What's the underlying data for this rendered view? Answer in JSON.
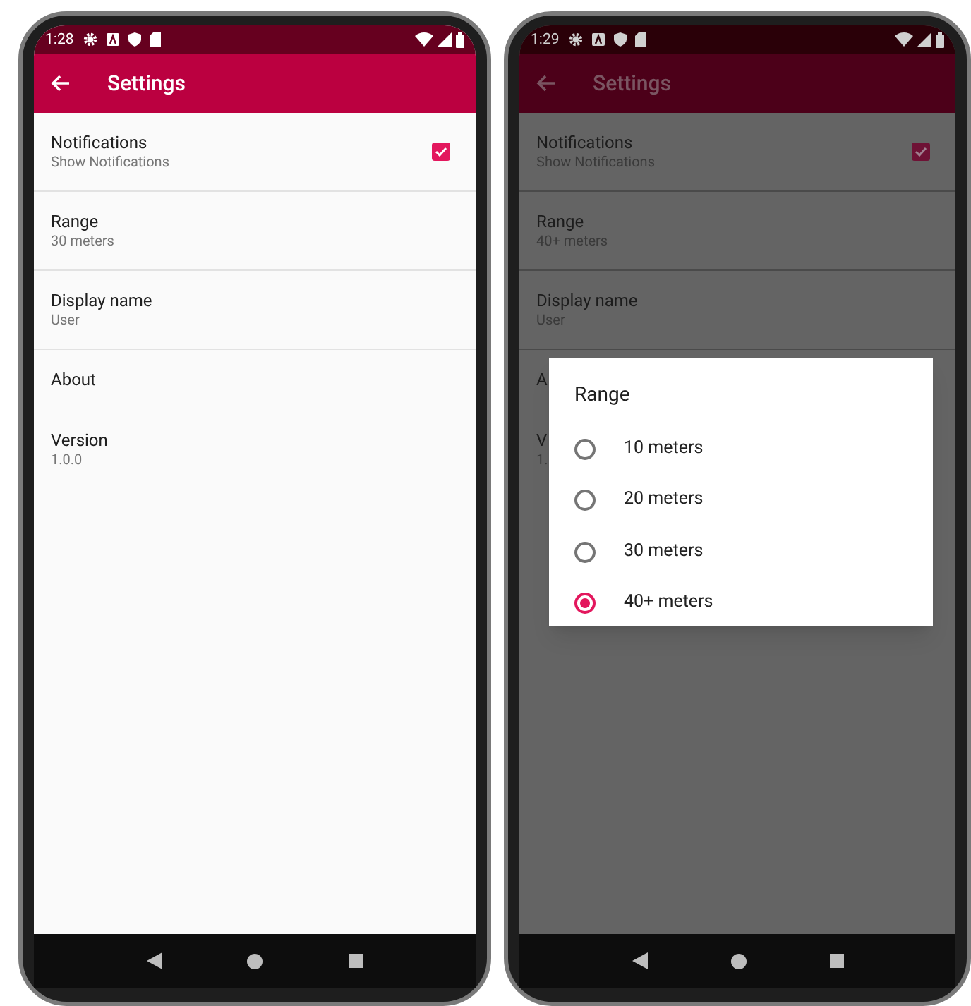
{
  "screens": [
    {
      "dimmed": false,
      "status_bar": {
        "time": "1:28"
      },
      "app_bar": {
        "title": "Settings"
      },
      "preferences": [
        {
          "kind": "checkbox",
          "title": "Notifications",
          "summary": "Show Notifications",
          "checked": true,
          "divider": true
        },
        {
          "kind": "text",
          "title": "Range",
          "summary": "30 meters",
          "divider": true
        },
        {
          "kind": "text",
          "title": "Display name",
          "summary": "User",
          "divider": true
        },
        {
          "kind": "text",
          "title": "About",
          "divider": false
        },
        {
          "kind": "text",
          "title": "Version",
          "summary": "1.0.0",
          "divider": false
        }
      ]
    },
    {
      "dimmed": true,
      "status_bar": {
        "time": "1:29"
      },
      "app_bar": {
        "title": "Settings"
      },
      "preferences": [
        {
          "kind": "checkbox",
          "title": "Notifications",
          "summary": "Show Notifications",
          "checked": true,
          "divider": true
        },
        {
          "kind": "text",
          "title": "Range",
          "summary": "40+ meters",
          "divider": true
        },
        {
          "kind": "text",
          "title": "Display name",
          "summary": "User",
          "divider": true
        },
        {
          "kind": "text",
          "title": "A",
          "divider": false
        },
        {
          "kind": "text",
          "title": "V",
          "summary": "1.",
          "divider": false
        }
      ],
      "dialog": {
        "title": "Range",
        "options": [
          {
            "label": "10 meters",
            "selected": false
          },
          {
            "label": "20 meters",
            "selected": false
          },
          {
            "label": "30 meters",
            "selected": false
          },
          {
            "label": "40+ meters",
            "selected": true
          }
        ]
      }
    }
  ]
}
